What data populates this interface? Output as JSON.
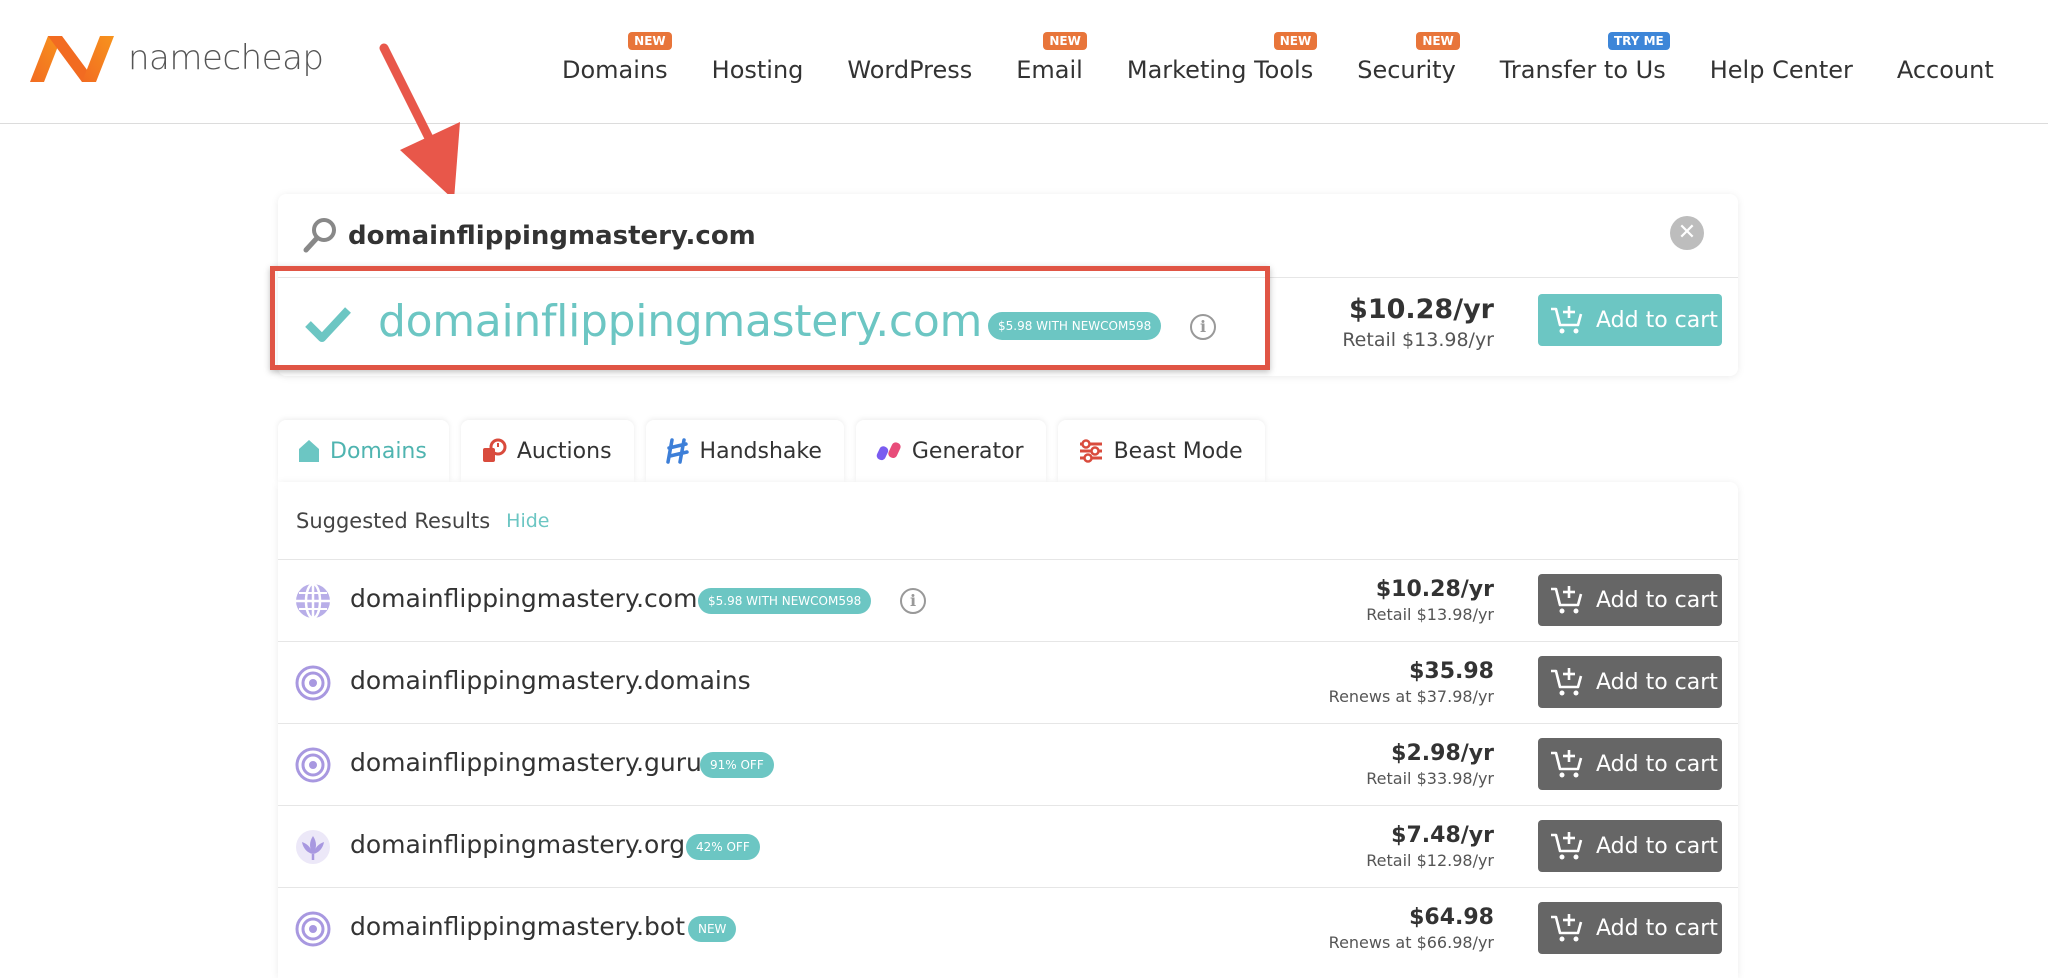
{
  "brand": {
    "name": "namecheap"
  },
  "nav": [
    {
      "label": "Domains",
      "badge": "NEW"
    },
    {
      "label": "Hosting",
      "badge": ""
    },
    {
      "label": "WordPress",
      "badge": ""
    },
    {
      "label": "Email",
      "badge": "NEW"
    },
    {
      "label": "Marketing Tools",
      "badge": "NEW"
    },
    {
      "label": "Security",
      "badge": "NEW"
    },
    {
      "label": "Transfer to Us",
      "badge": "TRY ME"
    },
    {
      "label": "Help Center",
      "badge": ""
    },
    {
      "label": "Account",
      "badge": ""
    }
  ],
  "search": {
    "value": "domainflippingmastery.com",
    "clear_icon": "close-icon"
  },
  "main_result": {
    "domain": "domainflippingmastery.com",
    "promo": "$5.98 WITH NEWCOM598",
    "price": "$10.28/yr",
    "retail": "Retail $13.98/yr",
    "button": "Add to cart"
  },
  "tabs": [
    {
      "label": "Domains",
      "icon": "house-icon",
      "active": true
    },
    {
      "label": "Auctions",
      "icon": "auction-icon",
      "active": false
    },
    {
      "label": "Handshake",
      "icon": "handshake-icon",
      "active": false
    },
    {
      "label": "Generator",
      "icon": "generator-icon",
      "active": false
    },
    {
      "label": "Beast Mode",
      "icon": "sliders-icon",
      "active": false
    }
  ],
  "suggested": {
    "title": "Suggested Results",
    "hide": "Hide",
    "rows": [
      {
        "domain": "domainflippingmastery.com",
        "pill": "$5.98 WITH NEWCOM598",
        "price": "$10.28/yr",
        "sub": "Retail $13.98/yr",
        "button": "Add to cart",
        "icon": "globe-icon"
      },
      {
        "domain": "domainflippingmastery.domains",
        "pill": "",
        "price": "$35.98",
        "sub": "Renews at $37.98/yr",
        "button": "Add to cart",
        "icon": "target-icon"
      },
      {
        "domain": "domainflippingmastery.guru",
        "pill": "91% OFF",
        "price": "$2.98/yr",
        "sub": "Retail $33.98/yr",
        "button": "Add to cart",
        "icon": "target-icon"
      },
      {
        "domain": "domainflippingmastery.org",
        "pill": "42% OFF",
        "price": "$7.48/yr",
        "sub": "Retail $12.98/yr",
        "button": "Add to cart",
        "icon": "lotus-icon"
      },
      {
        "domain": "domainflippingmastery.bot",
        "pill": "NEW",
        "price": "$64.98",
        "sub": "Renews at $66.98/yr",
        "button": "Add to cart",
        "icon": "target-icon"
      }
    ]
  },
  "colors": {
    "accent": "#6cc6c3",
    "brand_orange": "#f26b21",
    "highlight_red": "#e05545",
    "button_dark": "#666666"
  }
}
